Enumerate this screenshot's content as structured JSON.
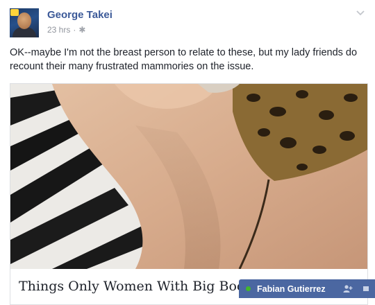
{
  "post": {
    "author": "George Takei",
    "time": "23 hrs",
    "separator": "·",
    "text": "OK--maybe I'm not the breast person to relate to these, but my lady friends do recount their many frustrated mammories on the issue."
  },
  "link": {
    "title": "Things Only Women With Big Boobs"
  },
  "chat": {
    "name": "Fabian Gutierrez",
    "status_color": "#42b72a",
    "tab_color": "#4b67a1"
  },
  "colors": {
    "author_link": "#3b5998",
    "meta_text": "#90949c"
  }
}
